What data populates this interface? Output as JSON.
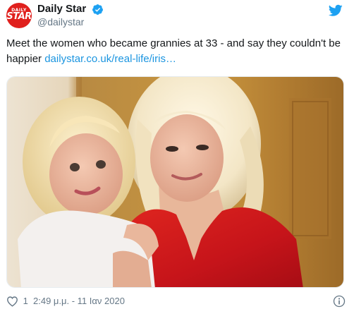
{
  "account": {
    "display_name": "Daily Star",
    "handle": "@dailystar",
    "avatar_logo_top": "DAILY",
    "avatar_logo_main": "STAR"
  },
  "tweet": {
    "text": "Meet the women who became grannies at 33 - and say they couldn't be happier",
    "link": "dailystar.co.uk/real-life/iris…"
  },
  "media": {
    "kind": "photo"
  },
  "footer": {
    "like_count": "1",
    "timestamp": "2:49 μ.μ. - 11 Ιαν 2020"
  },
  "colors": {
    "link": "#1b95e0",
    "verified": "#1da1f2",
    "twitter_bird": "#1da1f2",
    "avatar_red": "#e0201d",
    "muted_text": "#657786"
  },
  "icons": [
    "verified-badge-icon",
    "twitter-bird-icon",
    "heart-icon",
    "info-icon"
  ]
}
